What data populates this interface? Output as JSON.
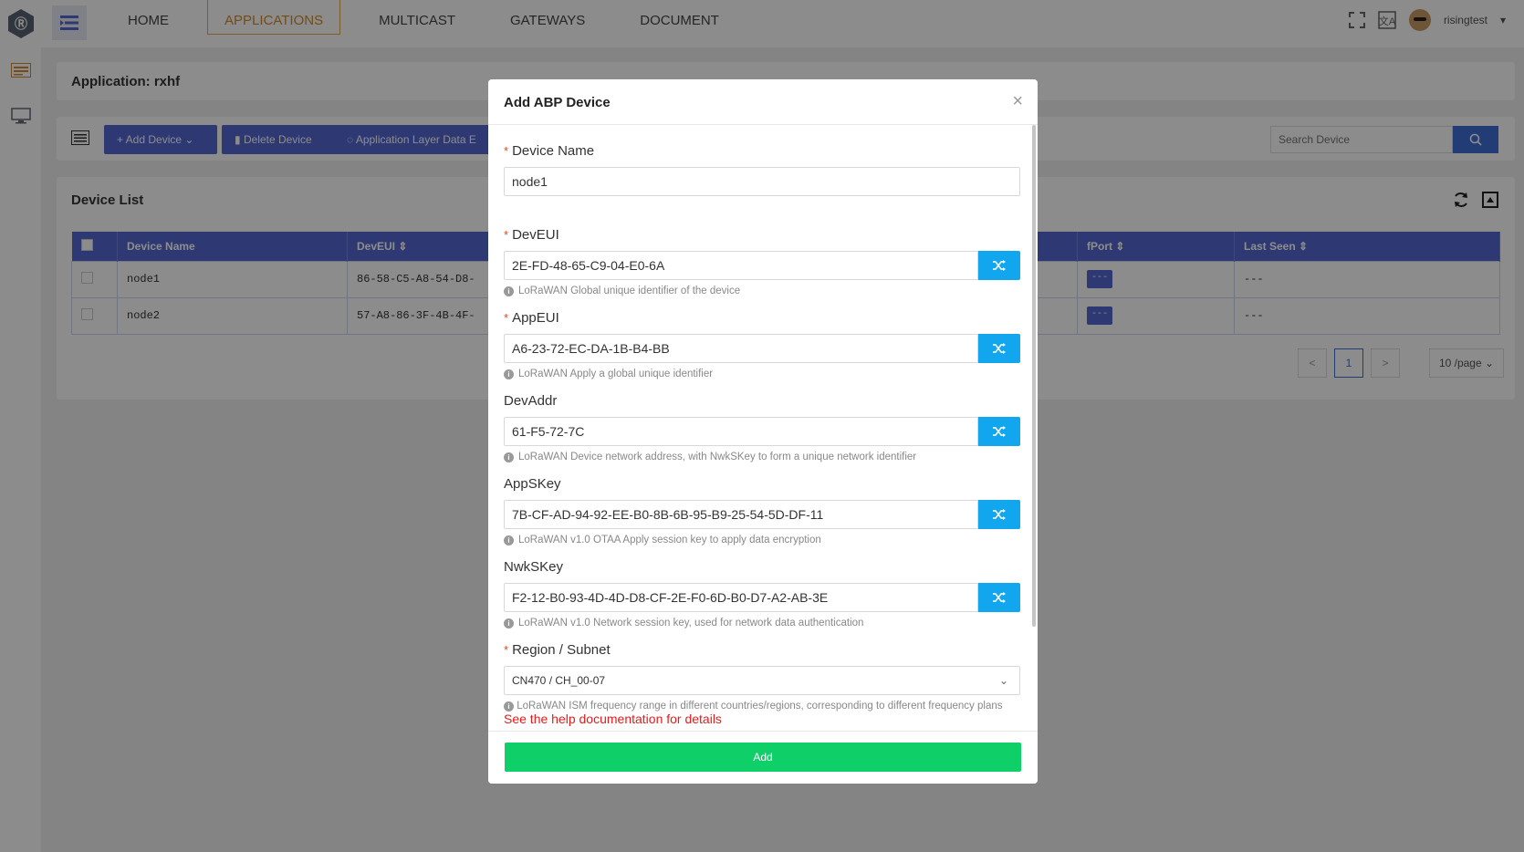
{
  "nav": {
    "items": [
      "HOME",
      "APPLICATIONS",
      "MULTICAST",
      "GATEWAYS",
      "DOCUMENT"
    ],
    "active_index": 1,
    "username": "risingtest"
  },
  "application": {
    "title": "Application: rxhf"
  },
  "toolbar": {
    "add_device": "+ Add Device",
    "delete_device": "Delete Device",
    "app_layer": "Application Layer Data E",
    "search_placeholder": "Search Device"
  },
  "device_list": {
    "title": "Device List",
    "columns": [
      "Device Name",
      "DevEUI",
      "fPort",
      "Last Seen"
    ],
    "rows": [
      {
        "name": "node1",
        "deveui": "86-58-C5-A8-54-D8-",
        "fport": "---",
        "last_seen": "---"
      },
      {
        "name": "node2",
        "deveui": "57-A8-86-3F-4B-4F-",
        "fport": "---",
        "last_seen": "---"
      }
    ],
    "pager": {
      "prev": "<",
      "page": "1",
      "next": ">",
      "page_size": "10 /page"
    }
  },
  "modal": {
    "title": "Add ABP Device",
    "close": "×",
    "device_name": {
      "label": "Device Name",
      "value": "node1"
    },
    "deveui": {
      "label": "DevEUI",
      "value": "2E-FD-48-65-C9-04-E0-6A",
      "hint": "LoRaWAN Global unique identifier of the device"
    },
    "appeui": {
      "label": "AppEUI",
      "value": "A6-23-72-EC-DA-1B-B4-BB",
      "hint": "LoRaWAN Apply a global unique identifier"
    },
    "devaddr": {
      "label": "DevAddr",
      "value": "61-F5-72-7C",
      "hint": "LoRaWAN Device network address, with NwkSKey to form a unique network identifier"
    },
    "appskey": {
      "label": "AppSKey",
      "value": "7B-CF-AD-94-92-EE-B0-8B-6B-95-B9-25-54-5D-DF-11",
      "hint": "LoRaWAN v1.0 OTAA Apply session key to apply data encryption"
    },
    "nwkskey": {
      "label": "NwkSKey",
      "value": "F2-12-B0-93-4D-4D-D8-CF-2E-F0-6D-B0-D7-A2-AB-3E",
      "hint": "LoRaWAN v1.0 Network session key, used for network data authentication"
    },
    "region": {
      "label": "Region / Subnet",
      "value": "CN470 / CH_00-07",
      "hint": "LoRaWAN ISM frequency range in different countries/regions, corresponding to different frequency plans",
      "help_link": "See the help documentation for details"
    },
    "add_button": "Add"
  },
  "colors": {
    "primary": "#5468d4",
    "accent": "#12a6ef",
    "success": "#0fcf68",
    "active_nav": "#d38a2c",
    "required": "#e8472c",
    "link": "#e51b1b"
  }
}
